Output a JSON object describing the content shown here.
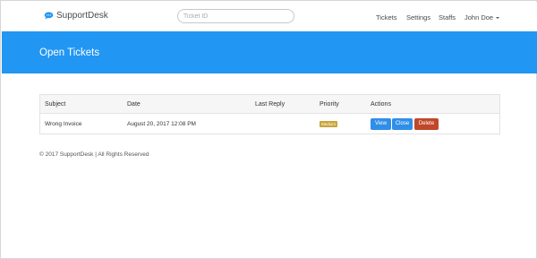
{
  "brand": {
    "name": "SupportDesk",
    "icon": "chat-bubble-icon",
    "color": "#2196f3"
  },
  "search": {
    "placeholder": "Ticket ID"
  },
  "nav": {
    "tickets": "Tickets",
    "settings": "Settings",
    "staffs": "Staffs",
    "user": "John Doe"
  },
  "banner": {
    "title": "Open Tickets",
    "color": "#2196f3"
  },
  "table": {
    "headers": {
      "subject": "Subject",
      "date": "Date",
      "last_reply": "Last Reply",
      "priority": "Priority",
      "actions": "Actions"
    },
    "rows": [
      {
        "subject": "Wrong Invoice",
        "date": "August 20, 2017 12:08 PM",
        "last_reply": "",
        "priority": "Medium",
        "priority_color": "#c8a43a",
        "actions": {
          "view": "View",
          "close": "Close",
          "delete": "Delete"
        }
      }
    ]
  },
  "footer": {
    "text": "© 2017 SupportDesk | All Rights Reserved"
  }
}
